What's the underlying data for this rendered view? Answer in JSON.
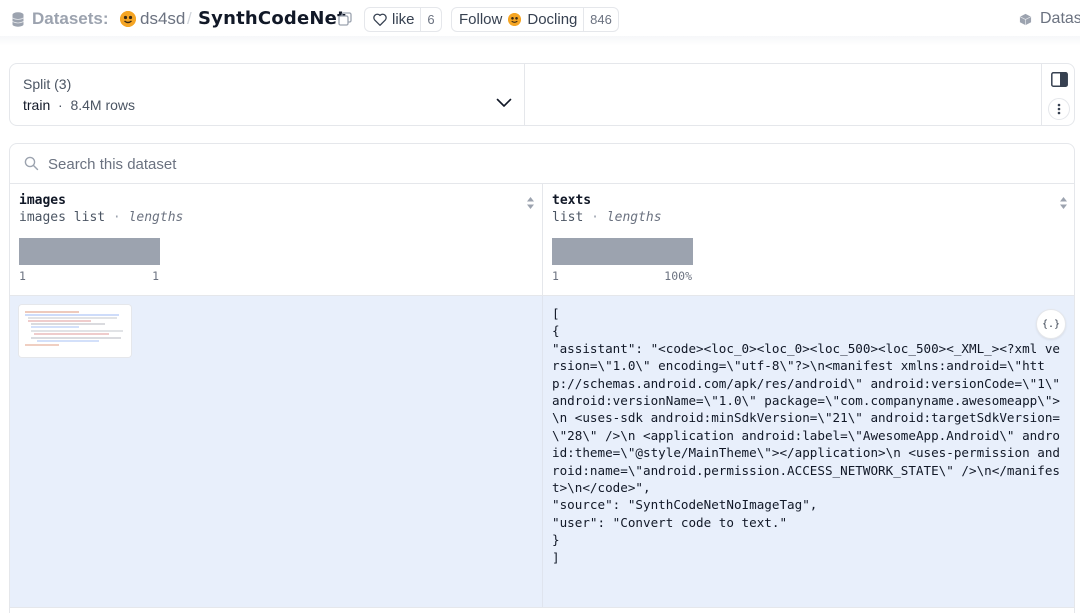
{
  "header": {
    "section": "Datasets:",
    "org": "ds4sd",
    "separator": "/",
    "dataset_name": "SynthCodeNet",
    "like_label": "like",
    "like_count": "6",
    "follow_label": "Follow",
    "follow_org": "Docling",
    "follow_count": "846",
    "right_label": "Datas"
  },
  "split": {
    "label": "Split (3)",
    "value": "train",
    "separator": "·",
    "rows": "8.4M rows"
  },
  "search": {
    "placeholder": "Search this dataset"
  },
  "columns": [
    {
      "name": "images",
      "type": "images list",
      "stat": "lengths",
      "hist_min": "1",
      "hist_max": "1"
    },
    {
      "name": "texts",
      "type": "list",
      "stat": "lengths",
      "hist_min": "1",
      "hist_max": "100%"
    }
  ],
  "row": {
    "texts": "[\n{\n\"assistant\": \"<code><loc_0><loc_0><loc_500><loc_500><_XML_><?xml version=\\\"1.0\\\" encoding=\\\"utf-8\\\"?>\\n<manifest xmlns:android=\\\"http://schemas.android.com/apk/res/android\\\" android:versionCode=\\\"1\\\" android:versionName=\\\"1.0\\\" package=\\\"com.companyname.awesomeapp\\\">\\n <uses-sdk android:minSdkVersion=\\\"21\\\" android:targetSdkVersion=\\\"28\\\" />\\n <application android:label=\\\"AwesomeApp.Android\\\" android:theme=\\\"@style/MainTheme\\\"></application>\\n <uses-permission android:name=\\\"android.permission.ACCESS_NETWORK_STATE\\\" />\\n</manifest>\\n</code>\",\n\"source\": \"SynthCodeNetNoImageTag\",\n\"user\": \"Convert code to text.\"\n}\n]",
    "json_button": "{.}"
  }
}
